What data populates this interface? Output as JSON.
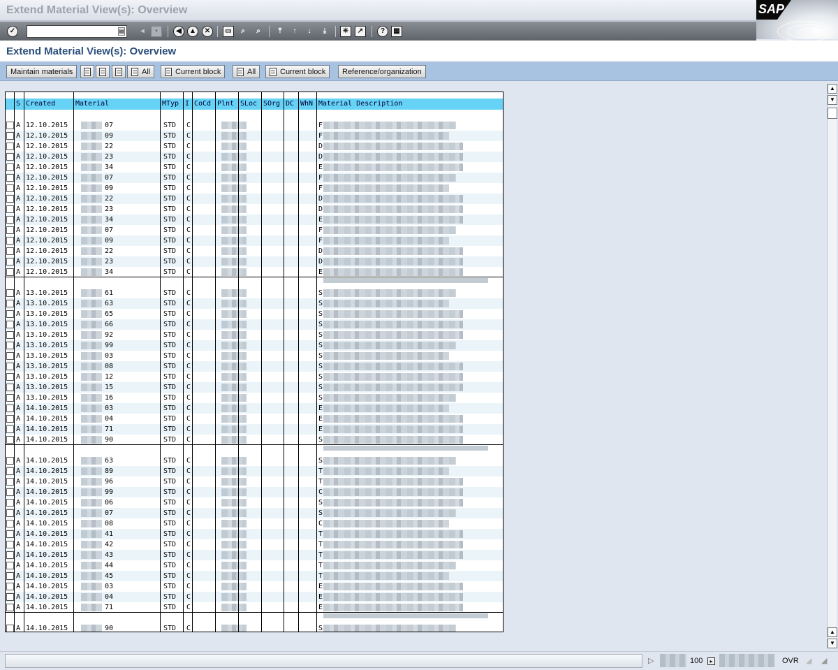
{
  "window": {
    "title": "Extend Material View(s): Overview"
  },
  "system_toolbar": {
    "command_field": {
      "value": "",
      "placeholder": ""
    },
    "icons": [
      "enter-icon",
      "save-icon",
      "back-icon",
      "exit-icon",
      "cancel-icon",
      "print-icon",
      "find-icon",
      "find-next-icon",
      "first-page-icon",
      "previous-page-icon",
      "next-page-icon",
      "last-page-icon",
      "create-session-icon",
      "shortcut-icon",
      "help-icon",
      "customize-layout-icon"
    ]
  },
  "screen": {
    "title": "Extend Material View(s): Overview"
  },
  "app_toolbar": {
    "maintain_materials": "Maintain materials",
    "select_all_1": "All",
    "select_block_1": "Current block",
    "deselect_all_2": "All",
    "deselect_block_2": "Current block",
    "reference_org": "Reference/organization"
  },
  "grid": {
    "columns": {
      "s": "S",
      "created": "Created",
      "material": "Material",
      "mtyp": "MTyp",
      "i": "I",
      "cocd": "CoCd",
      "plnt": "Plnt",
      "sloc": "SLoc",
      "sorg": "SOrg",
      "dc": "DC",
      "whn": "WhN",
      "description": "Material Description"
    },
    "groups": [
      {
        "rows": [
          {
            "s": "A",
            "created": "12.10.2015",
            "material_tail": "07",
            "mtyp": "STD",
            "i": "C",
            "desc_initial": "F"
          },
          {
            "s": "A",
            "created": "12.10.2015",
            "material_tail": "09",
            "mtyp": "STD",
            "i": "C",
            "desc_initial": "F"
          },
          {
            "s": "A",
            "created": "12.10.2015",
            "material_tail": "22",
            "mtyp": "STD",
            "i": "C",
            "desc_initial": "D"
          },
          {
            "s": "A",
            "created": "12.10.2015",
            "material_tail": "23",
            "mtyp": "STD",
            "i": "C",
            "desc_initial": "D"
          },
          {
            "s": "A",
            "created": "12.10.2015",
            "material_tail": "34",
            "mtyp": "STD",
            "i": "C",
            "desc_initial": "E"
          },
          {
            "s": "A",
            "created": "12.10.2015",
            "material_tail": "07",
            "mtyp": "STD",
            "i": "C",
            "desc_initial": "F"
          },
          {
            "s": "A",
            "created": "12.10.2015",
            "material_tail": "09",
            "mtyp": "STD",
            "i": "C",
            "desc_initial": "F"
          },
          {
            "s": "A",
            "created": "12.10.2015",
            "material_tail": "22",
            "mtyp": "STD",
            "i": "C",
            "desc_initial": "D"
          },
          {
            "s": "A",
            "created": "12.10.2015",
            "material_tail": "23",
            "mtyp": "STD",
            "i": "C",
            "desc_initial": "D"
          },
          {
            "s": "A",
            "created": "12.10.2015",
            "material_tail": "34",
            "mtyp": "STD",
            "i": "C",
            "desc_initial": "E"
          },
          {
            "s": "A",
            "created": "12.10.2015",
            "material_tail": "07",
            "mtyp": "STD",
            "i": "C",
            "desc_initial": "F"
          },
          {
            "s": "A",
            "created": "12.10.2015",
            "material_tail": "09",
            "mtyp": "STD",
            "i": "C",
            "desc_initial": "F"
          },
          {
            "s": "A",
            "created": "12.10.2015",
            "material_tail": "22",
            "mtyp": "STD",
            "i": "C",
            "desc_initial": "D"
          },
          {
            "s": "A",
            "created": "12.10.2015",
            "material_tail": "23",
            "mtyp": "STD",
            "i": "C",
            "desc_initial": "D"
          },
          {
            "s": "A",
            "created": "12.10.2015",
            "material_tail": "34",
            "mtyp": "STD",
            "i": "C",
            "desc_initial": "E"
          }
        ]
      },
      {
        "rows": [
          {
            "s": "A",
            "created": "13.10.2015",
            "material_tail": "61",
            "mtyp": "STD",
            "i": "C",
            "desc_initial": "S"
          },
          {
            "s": "A",
            "created": "13.10.2015",
            "material_tail": "63",
            "mtyp": "STD",
            "i": "C",
            "desc_initial": "S"
          },
          {
            "s": "A",
            "created": "13.10.2015",
            "material_tail": "65",
            "mtyp": "STD",
            "i": "C",
            "desc_initial": "S"
          },
          {
            "s": "A",
            "created": "13.10.2015",
            "material_tail": "66",
            "mtyp": "STD",
            "i": "C",
            "desc_initial": "S"
          },
          {
            "s": "A",
            "created": "13.10.2015",
            "material_tail": "92",
            "mtyp": "STD",
            "i": "C",
            "desc_initial": "S"
          },
          {
            "s": "A",
            "created": "13.10.2015",
            "material_tail": "99",
            "mtyp": "STD",
            "i": "C",
            "desc_initial": "S"
          },
          {
            "s": "A",
            "created": "13.10.2015",
            "material_tail": "03",
            "mtyp": "STD",
            "i": "C",
            "desc_initial": "S"
          },
          {
            "s": "A",
            "created": "13.10.2015",
            "material_tail": "08",
            "mtyp": "STD",
            "i": "C",
            "desc_initial": "S"
          },
          {
            "s": "A",
            "created": "13.10.2015",
            "material_tail": "12",
            "mtyp": "STD",
            "i": "C",
            "desc_initial": "S"
          },
          {
            "s": "A",
            "created": "13.10.2015",
            "material_tail": "15",
            "mtyp": "STD",
            "i": "C",
            "desc_initial": "S"
          },
          {
            "s": "A",
            "created": "13.10.2015",
            "material_tail": "16",
            "mtyp": "STD",
            "i": "C",
            "desc_initial": "S"
          },
          {
            "s": "A",
            "created": "14.10.2015",
            "material_tail": "03",
            "mtyp": "STD",
            "i": "C",
            "desc_initial": "E"
          },
          {
            "s": "A",
            "created": "14.10.2015",
            "material_tail": "04",
            "mtyp": "STD",
            "i": "C",
            "desc_initial": "E"
          },
          {
            "s": "A",
            "created": "14.10.2015",
            "material_tail": "71",
            "mtyp": "STD",
            "i": "C",
            "desc_initial": "E"
          },
          {
            "s": "A",
            "created": "14.10.2015",
            "material_tail": "90",
            "mtyp": "STD",
            "i": "C",
            "desc_initial": "S"
          }
        ]
      },
      {
        "rows": [
          {
            "s": "A",
            "created": "14.10.2015",
            "material_tail": "63",
            "mtyp": "STD",
            "i": "C",
            "desc_initial": "S"
          },
          {
            "s": "A",
            "created": "14.10.2015",
            "material_tail": "89",
            "mtyp": "STD",
            "i": "C",
            "desc_initial": "T"
          },
          {
            "s": "A",
            "created": "14.10.2015",
            "material_tail": "96",
            "mtyp": "STD",
            "i": "C",
            "desc_initial": "T"
          },
          {
            "s": "A",
            "created": "14.10.2015",
            "material_tail": "99",
            "mtyp": "STD",
            "i": "C",
            "desc_initial": "C"
          },
          {
            "s": "A",
            "created": "14.10.2015",
            "material_tail": "06",
            "mtyp": "STD",
            "i": "C",
            "desc_initial": "S"
          },
          {
            "s": "A",
            "created": "14.10.2015",
            "material_tail": "07",
            "mtyp": "STD",
            "i": "C",
            "desc_initial": "S"
          },
          {
            "s": "A",
            "created": "14.10.2015",
            "material_tail": "08",
            "mtyp": "STD",
            "i": "C",
            "desc_initial": "C"
          },
          {
            "s": "A",
            "created": "14.10.2015",
            "material_tail": "41",
            "mtyp": "STD",
            "i": "C",
            "desc_initial": "T"
          },
          {
            "s": "A",
            "created": "14.10.2015",
            "material_tail": "42",
            "mtyp": "STD",
            "i": "C",
            "desc_initial": "T"
          },
          {
            "s": "A",
            "created": "14.10.2015",
            "material_tail": "43",
            "mtyp": "STD",
            "i": "C",
            "desc_initial": "T"
          },
          {
            "s": "A",
            "created": "14.10.2015",
            "material_tail": "44",
            "mtyp": "STD",
            "i": "C",
            "desc_initial": "T"
          },
          {
            "s": "A",
            "created": "14.10.2015",
            "material_tail": "45",
            "mtyp": "STD",
            "i": "C",
            "desc_initial": "T"
          },
          {
            "s": "A",
            "created": "14.10.2015",
            "material_tail": "03",
            "mtyp": "STD",
            "i": "C",
            "desc_initial": "E"
          },
          {
            "s": "A",
            "created": "14.10.2015",
            "material_tail": "04",
            "mtyp": "STD",
            "i": "C",
            "desc_initial": "E"
          },
          {
            "s": "A",
            "created": "14.10.2015",
            "material_tail": "71",
            "mtyp": "STD",
            "i": "C",
            "desc_initial": "E"
          }
        ]
      },
      {
        "rows": [
          {
            "s": "A",
            "created": "14.10.2015",
            "material_tail": "90",
            "mtyp": "STD",
            "i": "C",
            "desc_initial": "S"
          }
        ]
      }
    ]
  },
  "status_bar": {
    "zoom": "100",
    "mode": "OVR"
  },
  "colors": {
    "header_cell": "#66d2f6",
    "app_toolbar": "#a8c2e2",
    "title_text": "#2a4e7a"
  }
}
